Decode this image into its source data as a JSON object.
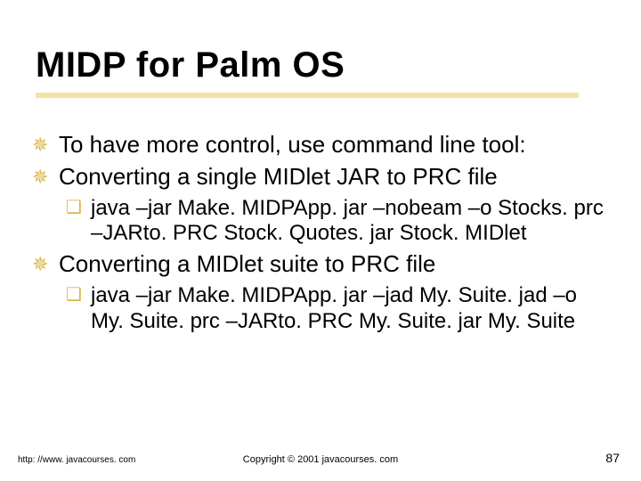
{
  "title": "MIDP for Palm OS",
  "bullets": {
    "b1": "To have more control, use command line tool:",
    "b2": "Converting a single MIDlet JAR to PRC file",
    "b2a": "java –jar Make. MIDPApp. jar –nobeam –o Stocks. prc –JARto. PRC Stock. Quotes. jar Stock. MIDlet",
    "b3": "Converting a MIDlet suite to PRC file",
    "b3a": "java –jar Make. MIDPApp. jar –jad My. Suite. jad –o My. Suite. prc –JARto. PRC My. Suite. jar My. Suite"
  },
  "footer": {
    "url": "http: //www. javacourses. com",
    "copyright": "Copyright © 2001 javacourses. com",
    "page": "87"
  },
  "glyphs": {
    "z": "✵",
    "y": "❑"
  },
  "colors": {
    "accent": "#d9b84a"
  }
}
